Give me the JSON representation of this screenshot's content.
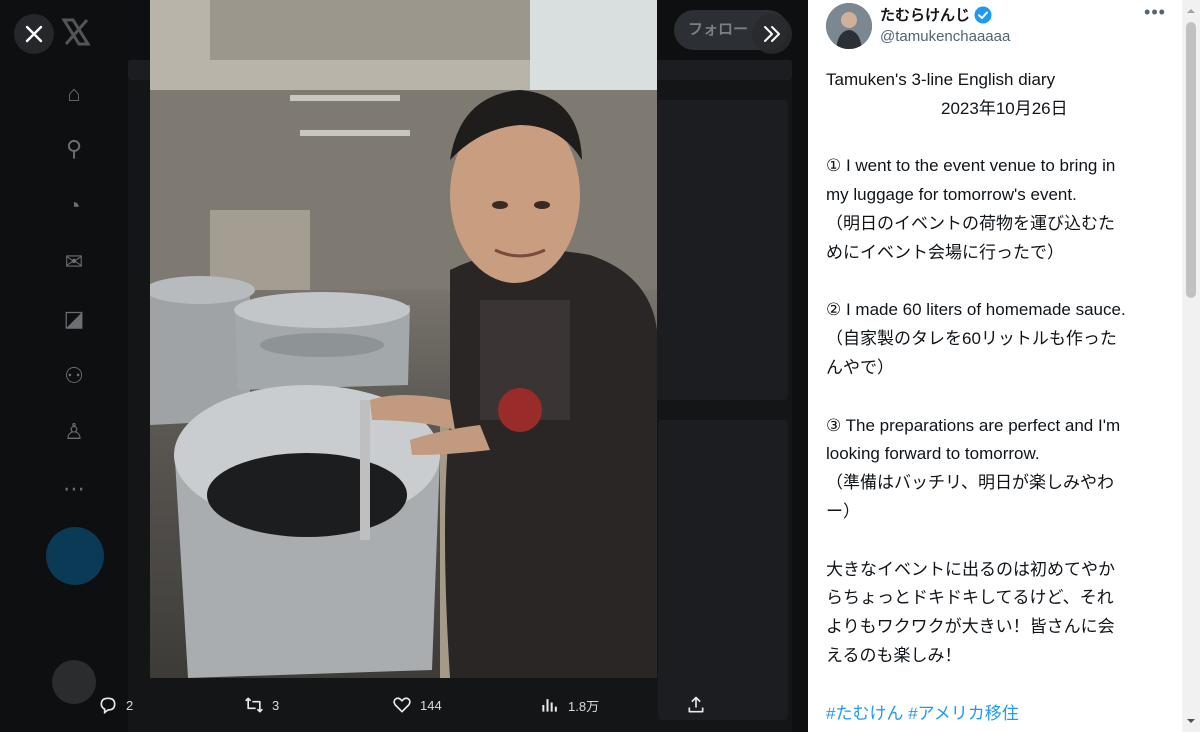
{
  "background": {
    "follow_label": "フォロー"
  },
  "actions": {
    "reply_count": "2",
    "repost_count": "3",
    "like_count": "144",
    "views_count": "1.8万"
  },
  "author": {
    "name": "たむらけんじ",
    "handle": "@tamukenchaaaaa",
    "verified": true
  },
  "tweet": {
    "title": "Tamuken's 3-line English diary",
    "date": "2023年10月26日",
    "line1_en_a": "① I went to the event venue to bring in",
    "line1_en_b": "my luggage for tomorrow's event.",
    "line1_ja_a": "（明日のイベントの荷物を運び込むた",
    "line1_ja_b": "めにイベント会場に行ったで）",
    "line2_en": "② I made 60 liters of homemade sauce.",
    "line2_ja_a": "（自家製のタレを60リットルも作った",
    "line2_ja_b": "んやで）",
    "line3_en_a": "③ The preparations are perfect and I'm",
    "line3_en_b": "looking forward to tomorrow.",
    "line3_ja_a": "（準備はバッチリ、明日が楽しみやわ",
    "line3_ja_b": "ー）",
    "closing_a": "大きなイベントに出るのは初めてやか",
    "closing_b": "らちょっとドキドキしてるけど、それ",
    "closing_c": "よりもワクワクが大きい！皆さんに会",
    "closing_d": "えるのも楽しみ！",
    "hashtag1": "#たむけん",
    "hashtag2": "#アメリカ移住"
  },
  "colors": {
    "accent": "#1d9bf0",
    "text": "#0f1419",
    "secondary": "#536471",
    "overlay": "#000000"
  },
  "icons": [
    "close-icon",
    "x-logo-icon",
    "expand-icon",
    "reply-icon",
    "repost-icon",
    "like-icon",
    "views-icon",
    "share-icon",
    "verified-badge-icon",
    "more-icon"
  ]
}
